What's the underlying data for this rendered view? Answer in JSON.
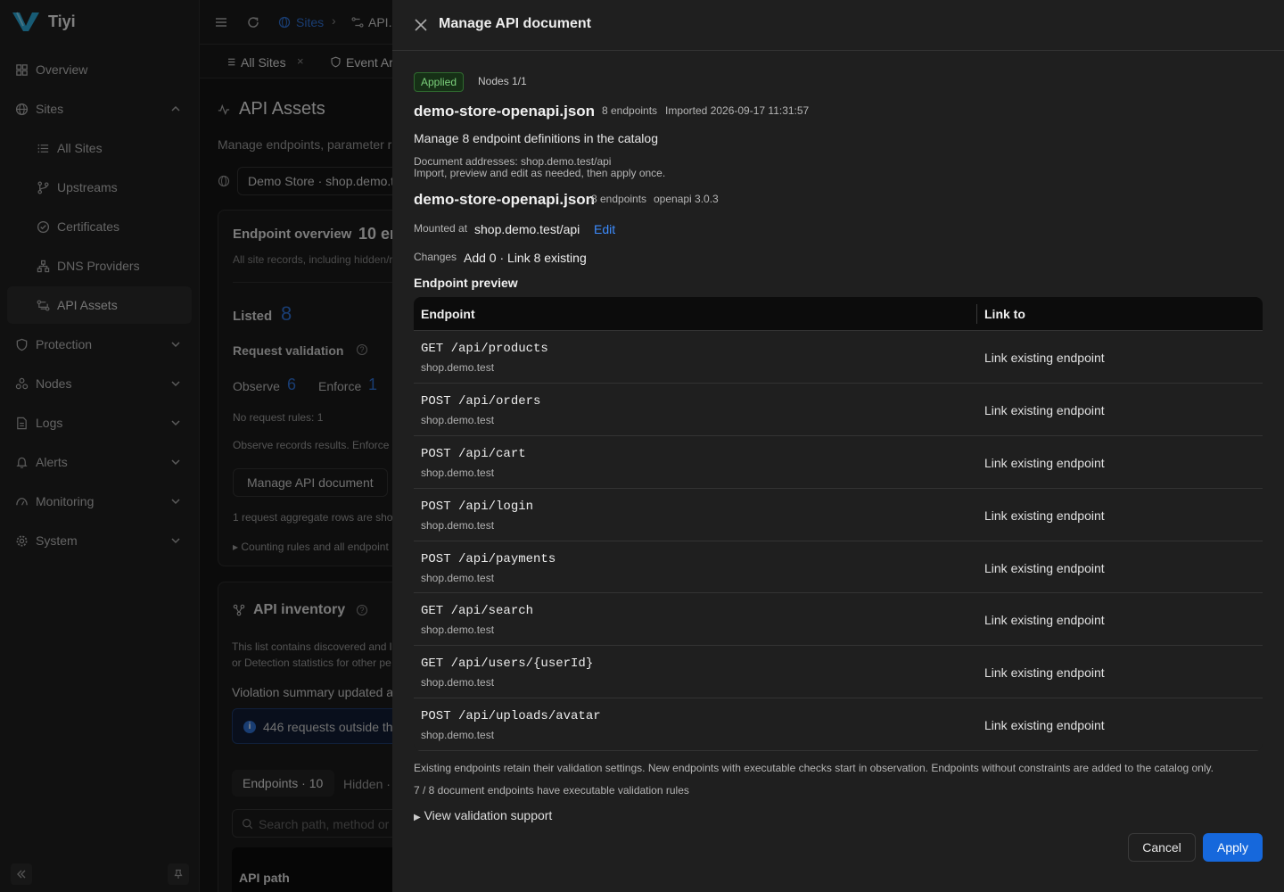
{
  "brand": {
    "name": "Tiyi"
  },
  "sidebar": {
    "items": [
      {
        "label": "Overview",
        "icon": "overview-icon"
      },
      {
        "label": "Sites",
        "icon": "globe-icon"
      },
      {
        "label": "All Sites",
        "icon": "list-icon"
      },
      {
        "label": "Upstreams",
        "icon": "branch-icon"
      },
      {
        "label": "Certificates",
        "icon": "check-circle-icon"
      },
      {
        "label": "DNS Providers",
        "icon": "network-icon"
      },
      {
        "label": "API Assets",
        "icon": "api-icon"
      },
      {
        "label": "Protection",
        "icon": "shield-icon"
      },
      {
        "label": "Nodes",
        "icon": "nodes-icon"
      },
      {
        "label": "Logs",
        "icon": "document-icon"
      },
      {
        "label": "Alerts",
        "icon": "bell-icon"
      },
      {
        "label": "Monitoring",
        "icon": "gauge-icon"
      },
      {
        "label": "System",
        "icon": "gear-icon"
      }
    ]
  },
  "topbar": {
    "breadcrumb_sites": "Sites",
    "breadcrumb_api": "API..."
  },
  "tabs": {
    "all_sites": "All Sites",
    "event": "Event Ar"
  },
  "background": {
    "title": "API Assets",
    "subtitle": "Manage endpoints, parameter r",
    "site_select": "Demo Store · shop.demo.t",
    "overview_title": "Endpoint overview",
    "overview_count": "10 er",
    "overview_desc": "All site records, including hidden/r",
    "listed_label": "Listed",
    "listed_value": "8",
    "request_validation": "Request validation",
    "observe_label": "Observe",
    "observe_value": "6",
    "enforce_label": "Enforce",
    "enforce_value": "1",
    "no_rules": "No request rules: 1",
    "observe_note": "Observe records results. Enforce",
    "manage_btn": "Manage API document",
    "aggregate_note": "1 request aggregate rows are sho",
    "counting_rules": "Counting rules and all endpoint",
    "inventory_title": "API inventory",
    "inventory_desc1": "This list contains discovered and l",
    "inventory_desc2": "or Detection statistics for other pe",
    "violation": "Violation summary updated a",
    "requests_outside": "446 requests outside th",
    "tab_endpoints": "Endpoints · 10",
    "tab_hidden": "Hidden ·",
    "search_placeholder": "Search path, method or",
    "api_path_header": "API path"
  },
  "drawer": {
    "title": "Manage API document",
    "status": "Applied",
    "nodes": "Nodes 1/1",
    "doc_name": "demo-store-openapi.json",
    "endpoints_count": "8 endpoints",
    "imported": "Imported 2026-09-17 11:31:57",
    "manage_desc": "Manage 8 endpoint definitions in the catalog",
    "doc_addresses": "Document addresses: shop.demo.test/api",
    "import_note": "Import, preview and edit as needed, then apply once.",
    "doc_name2": "demo-store-openapi.json",
    "endpoints_count2": "8 endpoints",
    "openapi_version": "openapi 3.0.3",
    "mounted_label": "Mounted at",
    "mounted_value": "shop.demo.test/api",
    "edit_link": "Edit",
    "changes_label": "Changes",
    "changes_value": "Add 0 · Link 8 existing",
    "preview_title": "Endpoint preview",
    "col_endpoint": "Endpoint",
    "col_link": "Link to",
    "rows": [
      {
        "path": "GET /api/products",
        "host": "shop.demo.test",
        "link": "Link existing endpoint"
      },
      {
        "path": "POST /api/orders",
        "host": "shop.demo.test",
        "link": "Link existing endpoint"
      },
      {
        "path": "POST /api/cart",
        "host": "shop.demo.test",
        "link": "Link existing endpoint"
      },
      {
        "path": "POST /api/login",
        "host": "shop.demo.test",
        "link": "Link existing endpoint"
      },
      {
        "path": "POST /api/payments",
        "host": "shop.demo.test",
        "link": "Link existing endpoint"
      },
      {
        "path": "GET /api/search",
        "host": "shop.demo.test",
        "link": "Link existing endpoint"
      },
      {
        "path": "GET /api/users/{userId}",
        "host": "shop.demo.test",
        "link": "Link existing endpoint"
      },
      {
        "path": "POST /api/uploads/avatar",
        "host": "shop.demo.test",
        "link": "Link existing endpoint"
      }
    ],
    "footnote": "Existing endpoints retain their validation settings. New endpoints with executable checks start in observation. Endpoints without constraints are added to the catalog only.",
    "rules_count": "7 / 8 document endpoints have executable validation rules",
    "validation_support": "View validation support",
    "cancel": "Cancel",
    "apply": "Apply"
  }
}
